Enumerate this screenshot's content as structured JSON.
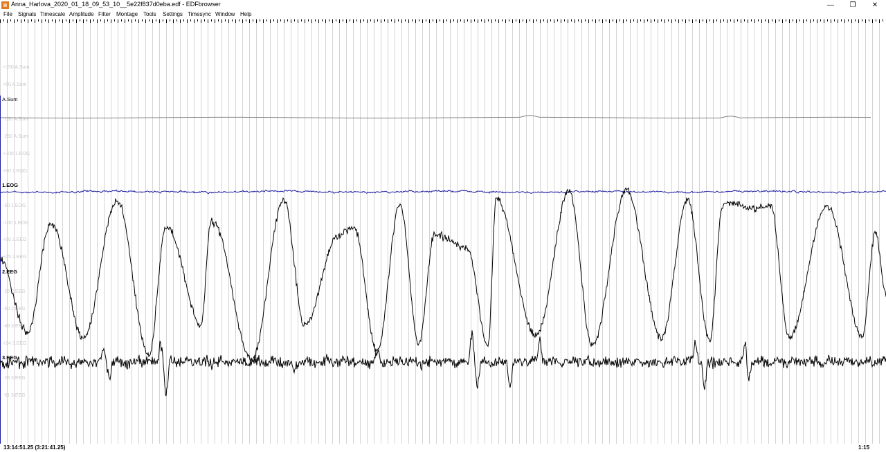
{
  "window": {
    "title": "Anna_Harlova_2020_01_18_09_53_10__5e22f837d0eba.edf - EDFbrowser",
    "icon": "edfbrowser-app-icon",
    "controls": {
      "minimize": "—",
      "restore": "❐",
      "close": "✕"
    }
  },
  "menu": [
    "File",
    "Signals",
    "Timescale",
    "Amplitude",
    "Filter",
    "Montage",
    "Tools",
    "Settings",
    "Timesync",
    "Window",
    "Help"
  ],
  "channels": [
    {
      "name": "A.Sum",
      "color": "#000000",
      "trace_color": "#808080",
      "scale_labels": [
        "+150 A.Sum",
        "+50 A.Sum",
        "-150 A.Sum",
        "-250 A.Sum"
      ]
    },
    {
      "name": "1.EOG",
      "color": "#1a1aa0",
      "trace_color": "#1a1aa0",
      "scale_labels": [
        "+100 1.EOG",
        "+50 1.EOG",
        "-50 1.EOG",
        "-100 1.EOG"
      ]
    },
    {
      "name": "2.EEG",
      "color": "#000000",
      "trace_color": "#000000",
      "scale_labels": [
        "+50 2.EEG",
        "+25 2.EEG",
        "-25 2.EEG",
        "-50 2.EEG",
        "-49 3.EEG"
      ]
    },
    {
      "name": "3.EEG",
      "color": "#000000",
      "trace_color": "#000000",
      "scale_labels": [
        "+24 3.EEG",
        "-26 3.EEG",
        "-51 3.EEG"
      ]
    }
  ],
  "status": {
    "start_time": "13:14:51.25 (3:21:41.25)",
    "page_duration": "1:15"
  },
  "colors": {
    "grid": "#d4d4d4",
    "background": "#ffffff",
    "active_channel_marker": "#1a1aa0"
  }
}
